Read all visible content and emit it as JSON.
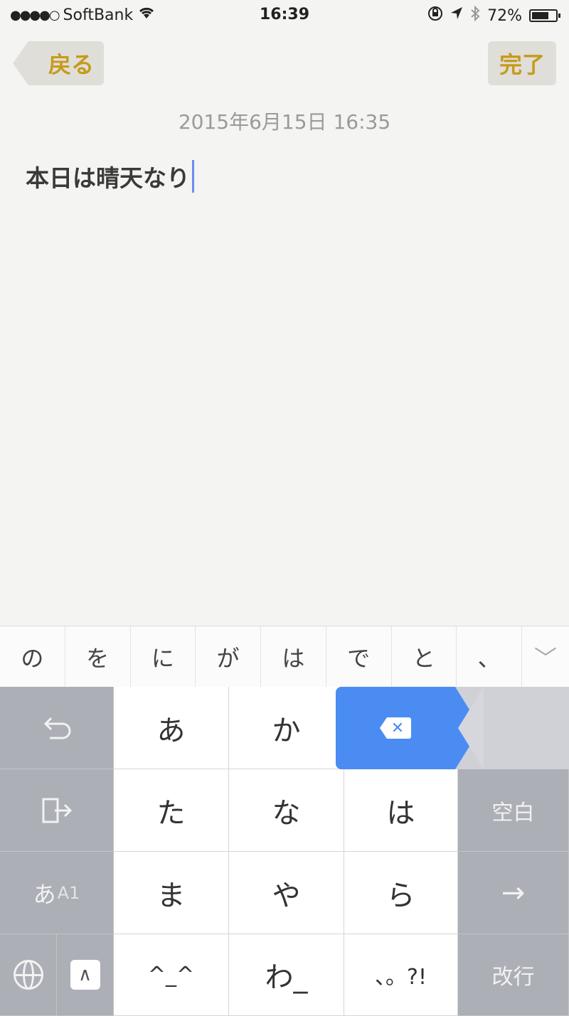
{
  "status_bar": {
    "signal": "●●●●○",
    "carrier": "SoftBank",
    "wifi_icon": "wifi-icon",
    "time": "16:39",
    "battery_percent": "72%",
    "battery_level": 0.72
  },
  "nav": {
    "back_label": "戻る",
    "done_label": "完了",
    "accent_color": "#c69b1b"
  },
  "note": {
    "date": "2015年6月15日 16:35",
    "body": "本日は晴天なり"
  },
  "candidates": [
    "の",
    "を",
    "に",
    "が",
    "は",
    "で",
    "と",
    "、"
  ],
  "candidate_toggle": "﹀",
  "keyboard": {
    "undo": "↺",
    "cursor_left": "⇦",
    "mode_main": "あ",
    "mode_sub": "A1",
    "rows": [
      [
        "あ",
        "か"
      ],
      [
        "た",
        "な",
        "は"
      ],
      [
        "ま",
        "や",
        "ら"
      ],
      [
        "^_^",
        "わ_",
        "、。?!"
      ]
    ],
    "space": "空白",
    "arrow": "→",
    "return": "改行",
    "emoji_key": "∧",
    "delete_color": "#4a8cf2"
  }
}
